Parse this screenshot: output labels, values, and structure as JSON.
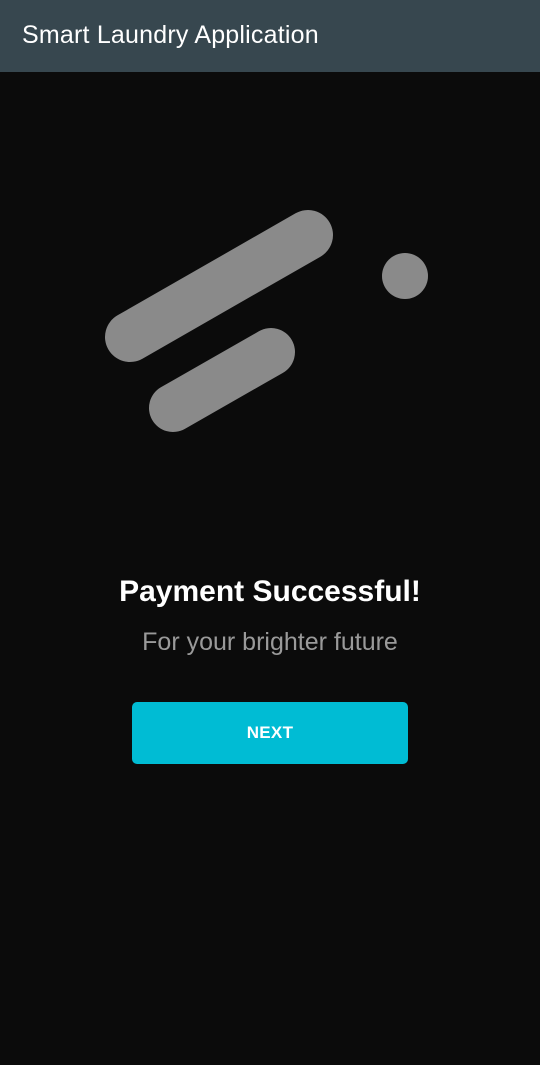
{
  "app_bar": {
    "title": "Smart Laundry Application",
    "background_color": "#37474f"
  },
  "logo": {
    "icon": "app-logo-icon",
    "color": "#8a8a8a"
  },
  "content": {
    "headline": "Payment Successful!",
    "subline": "For your brighter future"
  },
  "actions": {
    "next_label": "NEXT",
    "accent_color": "#00bcd4"
  },
  "colors": {
    "background": "#0b0b0b"
  }
}
